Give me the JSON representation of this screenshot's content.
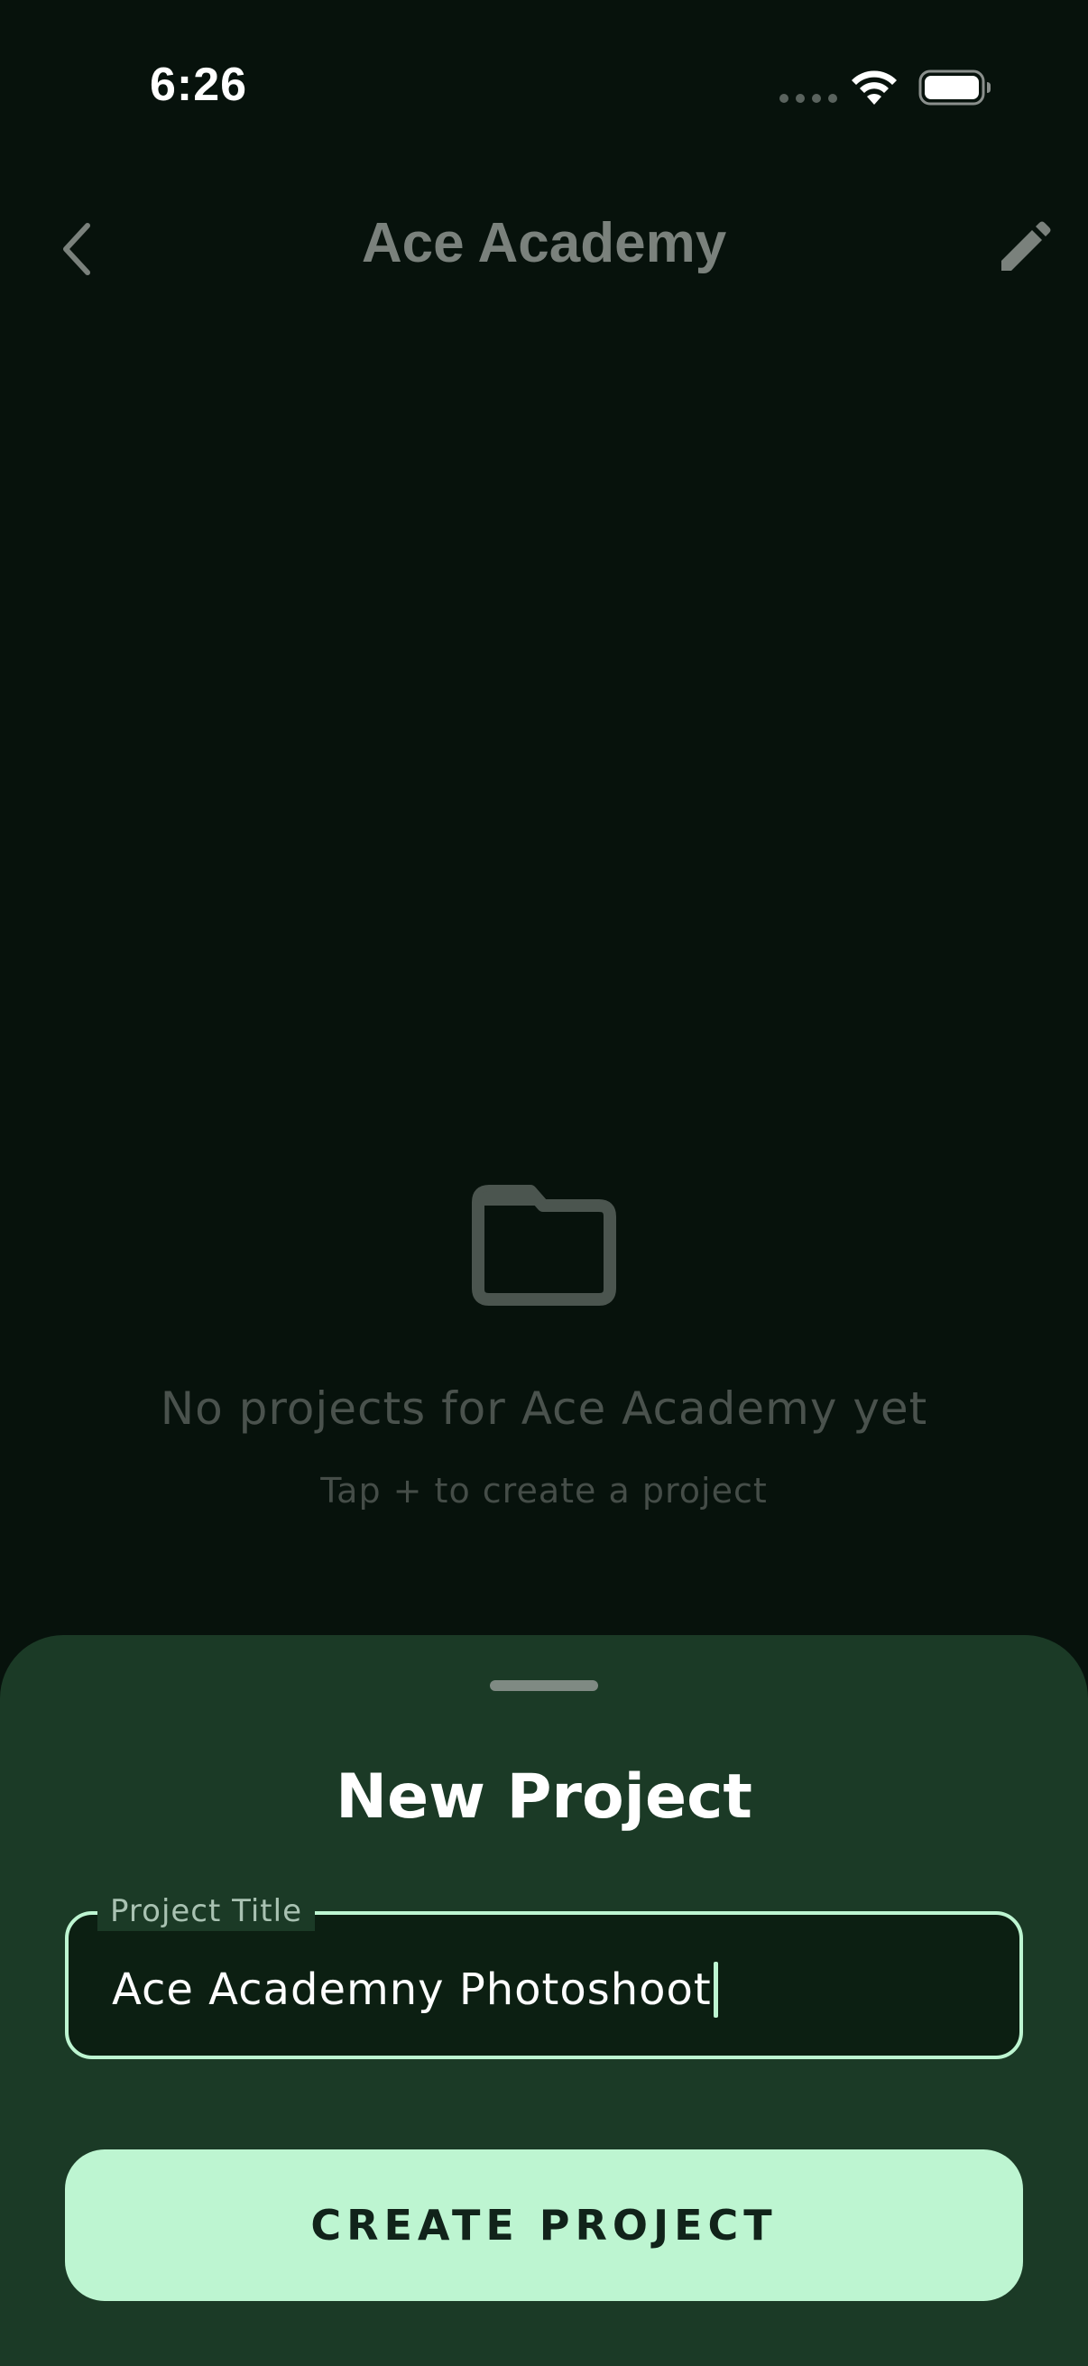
{
  "status_bar": {
    "time": "6:26"
  },
  "header": {
    "title": "Ace Academy",
    "back_icon": "chevron-left-icon",
    "edit_icon": "pencil-icon"
  },
  "empty_state": {
    "icon": "folder-icon",
    "title": "No projects for Ace Academy yet",
    "hint": "Tap + to create a project"
  },
  "sheet": {
    "title": "New Project",
    "title_field": {
      "label": "Project Title",
      "value": "Ace Academny Photoshoot"
    },
    "create_button_label": "CREATE PROJECT"
  },
  "colors": {
    "background": "#07120c",
    "sheet": "#1b3a26",
    "accent": "#bdf5d1",
    "button_text": "#11231a"
  }
}
